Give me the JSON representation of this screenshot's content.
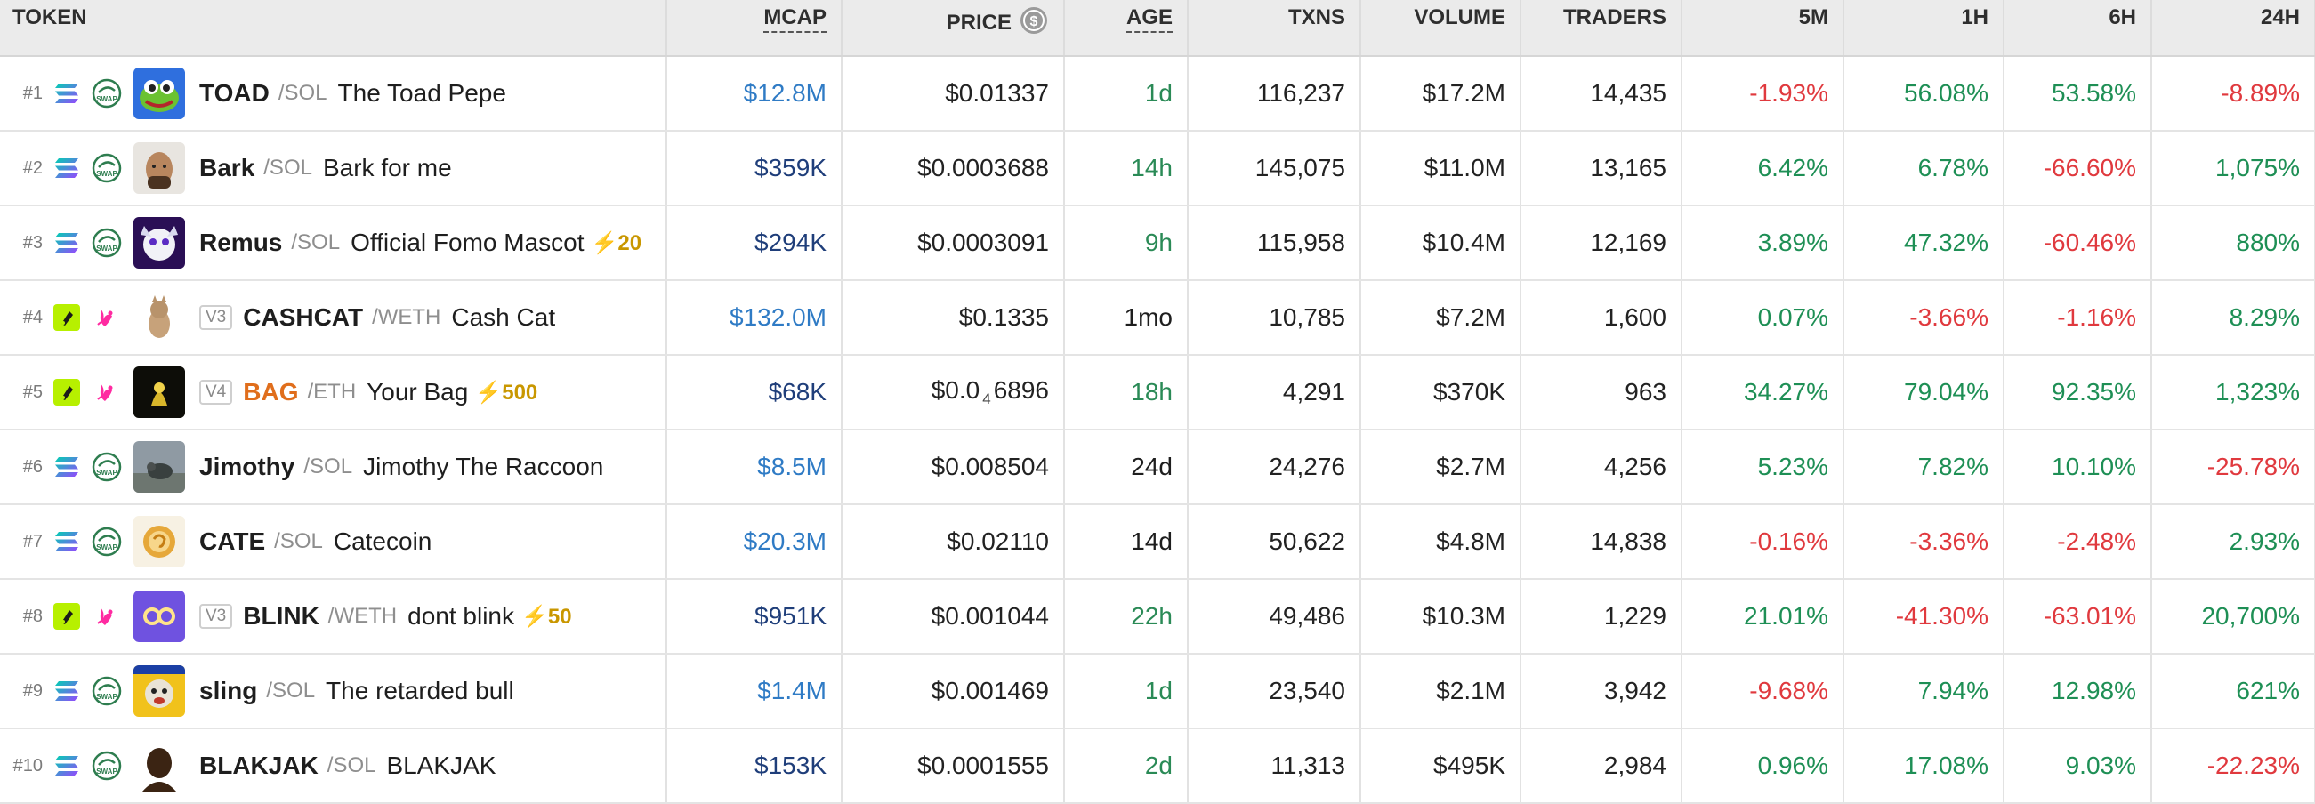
{
  "headers": {
    "token": "TOKEN",
    "mcap": "MCAP",
    "price": "PRICE",
    "age": "AGE",
    "txns": "TXNS",
    "volume": "VOLUME",
    "traders": "TRADERS",
    "m5": "5M",
    "h1": "1H",
    "h6": "6H",
    "h24": "24H"
  },
  "colors": {
    "positive": "#1e8f55",
    "negative": "#e0393e",
    "mcap_blue": "#2f7bc5",
    "mcap_navy": "#1f3e7a",
    "boost": "#c99700"
  },
  "rows": [
    {
      "rank": "#1",
      "chain_icon": "solana-icon",
      "dex_icon": "swap-icon",
      "version": "",
      "symbol": "TOAD",
      "quote": "/SOL",
      "name": "The Toad Pepe",
      "boost": "",
      "mcap": "$12.8M",
      "mcap_color": "blue",
      "price": "$0.01337",
      "price_sub": "",
      "price_rest": "",
      "age": "1d",
      "age_color": "green",
      "txns": "116,237",
      "volume": "$17.2M",
      "traders": "14,435",
      "m5": "-1.93%",
      "h1": "56.08%",
      "h6": "53.58%",
      "h24": "-8.89%"
    },
    {
      "rank": "#2",
      "chain_icon": "solana-icon",
      "dex_icon": "swap-icon",
      "version": "",
      "symbol": "Bark",
      "quote": "/SOL",
      "name": "Bark for me",
      "boost": "",
      "mcap": "$359K",
      "mcap_color": "navy",
      "price": "$0.0003688",
      "price_sub": "",
      "price_rest": "",
      "age": "14h",
      "age_color": "green",
      "txns": "145,075",
      "volume": "$11.0M",
      "traders": "13,165",
      "m5": "6.42%",
      "h1": "6.78%",
      "h6": "-66.60%",
      "h24": "1,075%"
    },
    {
      "rank": "#3",
      "chain_icon": "solana-icon",
      "dex_icon": "swap-icon",
      "version": "",
      "symbol": "Remus",
      "quote": "/SOL",
      "name": "Official Fomo Mascot",
      "boost": "20",
      "mcap": "$294K",
      "mcap_color": "navy",
      "price": "$0.0003091",
      "price_sub": "",
      "price_rest": "",
      "age": "9h",
      "age_color": "green",
      "txns": "115,958",
      "volume": "$10.4M",
      "traders": "12,169",
      "m5": "3.89%",
      "h1": "47.32%",
      "h6": "-60.46%",
      "h24": "880%"
    },
    {
      "rank": "#4",
      "chain_icon": "base-icon",
      "dex_icon": "uniswap-icon",
      "version": "V3",
      "symbol": "CASHCAT",
      "quote": "/WETH",
      "name": "Cash Cat",
      "boost": "",
      "mcap": "$132.0M",
      "mcap_color": "blue",
      "price": "$0.1335",
      "price_sub": "",
      "price_rest": "",
      "age": "1mo",
      "age_color": "dark",
      "txns": "10,785",
      "volume": "$7.2M",
      "traders": "1,600",
      "m5": "0.07%",
      "h1": "-3.66%",
      "h6": "-1.16%",
      "h24": "8.29%"
    },
    {
      "rank": "#5",
      "chain_icon": "base-icon",
      "dex_icon": "uniswap-icon",
      "version": "V4",
      "symbol": "BAG",
      "quote": "/ETH",
      "name": "Your Bag",
      "boost": "500",
      "mcap": "$68K",
      "mcap_color": "navy",
      "price": "$0.0",
      "price_sub": "4",
      "price_rest": "6896",
      "age": "18h",
      "age_color": "green",
      "txns": "4,291",
      "volume": "$370K",
      "traders": "963",
      "m5": "34.27%",
      "h1": "79.04%",
      "h6": "92.35%",
      "h24": "1,323%"
    },
    {
      "rank": "#6",
      "chain_icon": "solana-icon",
      "dex_icon": "swap-icon",
      "version": "",
      "symbol": "Jimothy",
      "quote": "/SOL",
      "name": "Jimothy The Raccoon",
      "boost": "",
      "mcap": "$8.5M",
      "mcap_color": "blue",
      "price": "$0.008504",
      "price_sub": "",
      "price_rest": "",
      "age": "24d",
      "age_color": "dark",
      "txns": "24,276",
      "volume": "$2.7M",
      "traders": "4,256",
      "m5": "5.23%",
      "h1": "7.82%",
      "h6": "10.10%",
      "h24": "-25.78%"
    },
    {
      "rank": "#7",
      "chain_icon": "solana-icon",
      "dex_icon": "swap-icon",
      "version": "",
      "symbol": "CATE",
      "quote": "/SOL",
      "name": "Catecoin",
      "boost": "",
      "mcap": "$20.3M",
      "mcap_color": "blue",
      "price": "$0.02110",
      "price_sub": "",
      "price_rest": "",
      "age": "14d",
      "age_color": "dark",
      "txns": "50,622",
      "volume": "$4.8M",
      "traders": "14,838",
      "m5": "-0.16%",
      "h1": "-3.36%",
      "h6": "-2.48%",
      "h24": "2.93%"
    },
    {
      "rank": "#8",
      "chain_icon": "base-icon",
      "dex_icon": "uniswap-icon",
      "version": "V3",
      "symbol": "BLINK",
      "quote": "/WETH",
      "name": "dont blink",
      "boost": "50",
      "mcap": "$951K",
      "mcap_color": "navy",
      "price": "$0.001044",
      "price_sub": "",
      "price_rest": "",
      "age": "22h",
      "age_color": "green",
      "txns": "49,486",
      "volume": "$10.3M",
      "traders": "1,229",
      "m5": "21.01%",
      "h1": "-41.30%",
      "h6": "-63.01%",
      "h24": "20,700%"
    },
    {
      "rank": "#9",
      "chain_icon": "solana-icon",
      "dex_icon": "swap-icon",
      "version": "",
      "symbol": "sling",
      "quote": "/SOL",
      "name": "The retarded bull",
      "boost": "",
      "mcap": "$1.4M",
      "mcap_color": "blue",
      "price": "$0.001469",
      "price_sub": "",
      "price_rest": "",
      "age": "1d",
      "age_color": "green",
      "txns": "23,540",
      "volume": "$2.1M",
      "traders": "3,942",
      "m5": "-9.68%",
      "h1": "7.94%",
      "h6": "12.98%",
      "h24": "621%"
    },
    {
      "rank": "#10",
      "chain_icon": "solana-icon",
      "dex_icon": "swap-icon",
      "version": "",
      "symbol": "BLAKJAK",
      "quote": "/SOL",
      "name": "BLAKJAK",
      "boost": "",
      "mcap": "$153K",
      "mcap_color": "navy",
      "price": "$0.0001555",
      "price_sub": "",
      "price_rest": "",
      "age": "2d",
      "age_color": "green",
      "txns": "11,313",
      "volume": "$495K",
      "traders": "2,984",
      "m5": "0.96%",
      "h1": "17.08%",
      "h6": "9.03%",
      "h24": "-22.23%"
    }
  ]
}
